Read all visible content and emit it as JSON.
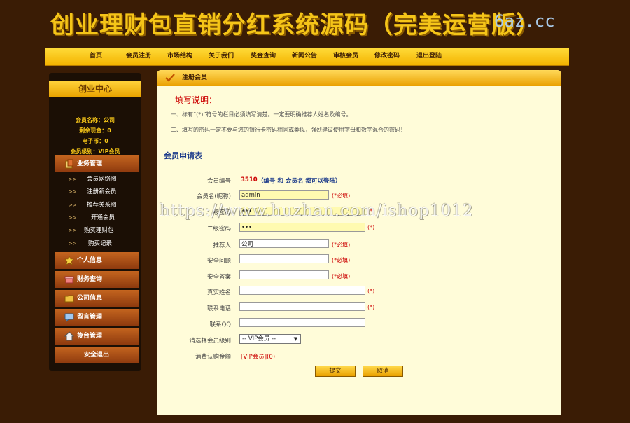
{
  "header": {
    "title": "创业理财包直销分红系统源码（完美运营版）",
    "domain": "6az.cc"
  },
  "topnav": {
    "items": [
      "首页",
      "会员注册",
      "市场结构",
      "关于我们",
      "奖金查询",
      "新闻公告",
      "审核会员",
      "修改密码",
      "退出登陆"
    ]
  },
  "sidebar": {
    "title": "创业中心",
    "member_info": [
      "会员名称：公司",
      "剩余现金：0",
      "电子币：0",
      "会员级别：VIP会员"
    ],
    "business_section": "业务管理",
    "business_items": [
      "会员网络图",
      "注册新会员",
      "推荐关系图",
      "开通会员",
      "购买理财包",
      "购买记录"
    ],
    "arrow": ">>",
    "sections": [
      "个人信息",
      "财务查询",
      "公司信息",
      "留言管理",
      "後台管理"
    ],
    "logout": "安全退出"
  },
  "main": {
    "header_title": "注册会员",
    "notes_title": "填写说明：",
    "notes": [
      "一、标有“(*)”符号的栏目必须填写清楚。一定要明确推荐人姓名及编号。",
      "二、填写的密码一定不要与您的银行卡密码相同或类似，强烈建议使用字母和数字混合的密码！"
    ],
    "form_title": "会员申请表",
    "form": {
      "member_no_label": "会员编号",
      "member_no_value": "3510",
      "member_no_hint": "（编号 和 会员名 都可以登陆）",
      "username_label": "会员名(昵称)",
      "username_value": "admin",
      "password1_label": "一级密码",
      "password1_value": "•••",
      "password2_label": "二级密码",
      "password2_value": "•••",
      "referrer_label": "推荐人",
      "referrer_value": "公司",
      "question_label": "安全问题",
      "answer_label": "安全答案",
      "realname_label": "真实姓名",
      "phone_label": "联系电话",
      "qq_label": "联系QQ",
      "level_label": "请选择会员级别",
      "level_value": "-- VIP会员 --",
      "amount_label": "消费认购金额",
      "amount_value": "[VIP会员](0)",
      "required_text": "(*必填)",
      "star_text": "(*)",
      "submit": "提交",
      "cancel": "取消"
    }
  },
  "watermark": "https://www.huzhan.com/ishop1012",
  "colors": {
    "background": "#3a1c05",
    "accent": "#f5c518",
    "required": "#cc0000"
  }
}
